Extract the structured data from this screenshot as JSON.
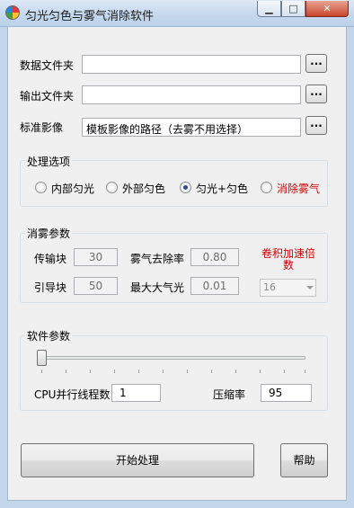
{
  "window": {
    "title": "匀光匀色与雾气消除软件",
    "min_icon": "minimize-icon",
    "max_icon": "maximize-icon",
    "close_icon": "close-icon"
  },
  "paths": {
    "data_folder": {
      "label": "数据文件夹",
      "value": "",
      "browse": "..."
    },
    "output_folder": {
      "label": "输出文件夹",
      "value": "",
      "browse": "..."
    },
    "reference_image": {
      "label": "标准影像",
      "value": "模板影像的路径（去雾不用选择）",
      "browse": "..."
    }
  },
  "options": {
    "title": "处理选项",
    "radios": [
      {
        "label": "内部匀光",
        "checked": false,
        "color": "#000000"
      },
      {
        "label": "外部匀色",
        "checked": false,
        "color": "#000000"
      },
      {
        "label": "匀光+匀色",
        "checked": true,
        "color": "#000000"
      },
      {
        "label": "消除雾气",
        "checked": false,
        "color": "#d40000"
      }
    ]
  },
  "dehaze": {
    "title": "消雾参数",
    "transfer_block": {
      "label": "传输块",
      "value": "30"
    },
    "haze_removal_rate": {
      "label": "雾气去除率",
      "value": "0.80"
    },
    "guide_block": {
      "label": "引导块",
      "value": "50"
    },
    "max_atmosphere": {
      "label": "最大大气光",
      "value": "0.01"
    },
    "conv_accel_label": "卷积加速倍数",
    "conv_accel_value": "16"
  },
  "software": {
    "title": "软件参数",
    "slider_value": 0,
    "cpu_threads": {
      "label": "CPU并行线程数",
      "value": "1"
    },
    "compression": {
      "label": "压缩率",
      "value": "95"
    }
  },
  "actions": {
    "start": "开始处理",
    "help": "帮助"
  },
  "colors": {
    "accent_red": "#d40000",
    "title_bar": "#c7d9ee",
    "close_button": "#c9462c"
  }
}
